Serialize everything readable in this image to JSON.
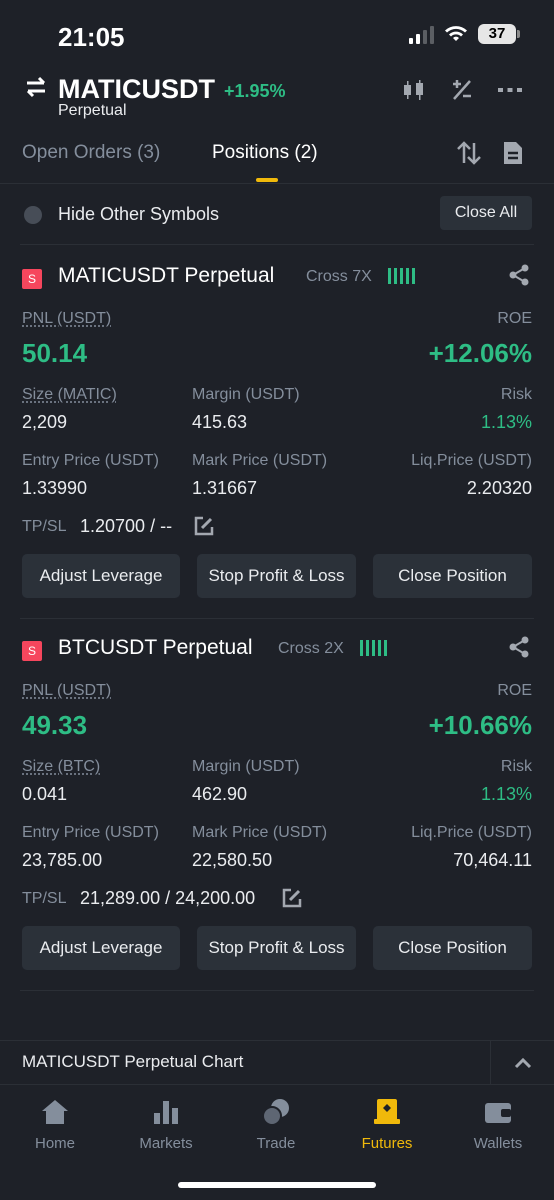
{
  "status": {
    "time": "21:05",
    "battery": "37"
  },
  "header": {
    "symbol": "MATICUSDT",
    "change": "+1.95%",
    "contract": "Perpetual"
  },
  "tabs": {
    "open_orders": "Open Orders (3)",
    "positions": "Positions (2)"
  },
  "filter": {
    "hide_label": "Hide Other Symbols",
    "close_all": "Close All"
  },
  "positions": [
    {
      "side": "S",
      "title": "MATICUSDT Perpetual",
      "margin_mode": "Cross 7X",
      "pnl_label": "PNL (USDT)",
      "pnl": "50.14",
      "roe_label": "ROE",
      "roe": "+12.06%",
      "size_label": "Size (MATIC)",
      "size": "2,209",
      "margin_label": "Margin (USDT)",
      "margin": "415.63",
      "risk_label": "Risk",
      "risk": "1.13%",
      "entry_label": "Entry Price (USDT)",
      "entry": "1.33990",
      "mark_label": "Mark Price (USDT)",
      "mark": "1.31667",
      "liq_label": "Liq.Price (USDT)",
      "liq": "2.20320",
      "tpsl_label": "TP/SL",
      "tpsl": "1.20700 / --",
      "btn_leverage": "Adjust Leverage",
      "btn_stop": "Stop Profit & Loss",
      "btn_close": "Close Position"
    },
    {
      "side": "S",
      "title": "BTCUSDT Perpetual",
      "margin_mode": "Cross 2X",
      "pnl_label": "PNL (USDT)",
      "pnl": "49.33",
      "roe_label": "ROE",
      "roe": "+10.66%",
      "size_label": "Size (BTC)",
      "size": "0.041",
      "margin_label": "Margin (USDT)",
      "margin": "462.90",
      "risk_label": "Risk",
      "risk": "1.13%",
      "entry_label": "Entry Price (USDT)",
      "entry": "23,785.00",
      "mark_label": "Mark Price (USDT)",
      "mark": "22,580.50",
      "liq_label": "Liq.Price (USDT)",
      "liq": "70,464.11",
      "tpsl_label": "TP/SL",
      "tpsl": "21,289.00 / 24,200.00",
      "btn_leverage": "Adjust Leverage",
      "btn_stop": "Stop Profit & Loss",
      "btn_close": "Close Position"
    }
  ],
  "chart_bar": {
    "label": "MATICUSDT Perpetual  Chart"
  },
  "nav": {
    "items": [
      {
        "label": "Home",
        "icon": "home-icon"
      },
      {
        "label": "Markets",
        "icon": "markets-icon"
      },
      {
        "label": "Trade",
        "icon": "trade-icon"
      },
      {
        "label": "Futures",
        "icon": "futures-icon"
      },
      {
        "label": "Wallets",
        "icon": "wallets-icon"
      }
    ],
    "active": "Futures"
  },
  "colors": {
    "accent": "#f0b90b",
    "up": "#2ebd85",
    "down": "#f6465d",
    "bg": "#1e2128"
  }
}
